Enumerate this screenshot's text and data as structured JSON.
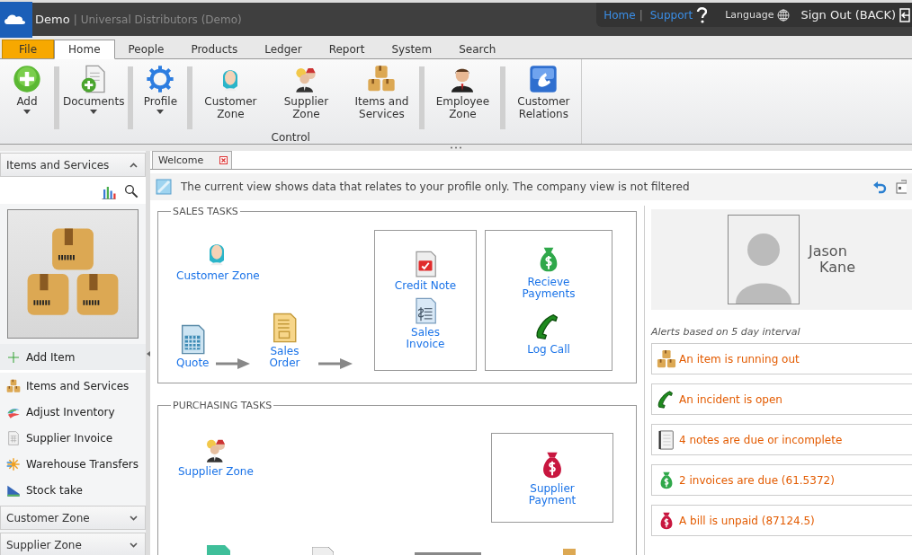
{
  "header": {
    "app": "Demo",
    "separator": "|",
    "company": "Universal Distributors (Demo)",
    "links": [
      {
        "label": "Home",
        "kind": "link"
      },
      {
        "label": "Support",
        "kind": "help"
      },
      {
        "label": "Language",
        "kind": "globe"
      },
      {
        "label": "Sign Out (BACK)",
        "kind": "exit"
      }
    ]
  },
  "menu_tabs": [
    {
      "label": "File",
      "kind": "file",
      "selected": false
    },
    {
      "label": "Home",
      "kind": "tab",
      "selected": true
    },
    {
      "label": "People",
      "kind": "tab",
      "selected": false
    },
    {
      "label": "Products",
      "kind": "tab",
      "selected": false
    },
    {
      "label": "Ledger",
      "kind": "tab",
      "selected": false
    },
    {
      "label": "Report",
      "kind": "tab",
      "selected": false
    },
    {
      "label": "System",
      "kind": "tab",
      "selected": false
    },
    {
      "label": "Search",
      "kind": "tab",
      "selected": false
    }
  ],
  "ribbon": {
    "group_label": "Control",
    "buttons": [
      {
        "label": "Add",
        "kind": "add",
        "dropdown": true
      },
      {
        "label": "Documents",
        "kind": "documents",
        "dropdown": true
      },
      {
        "label": "Profile",
        "kind": "gear",
        "dropdown": true
      },
      {
        "label": "Customer Zone",
        "kind": "customer",
        "dropdown": false
      },
      {
        "label": "Supplier Zone",
        "kind": "supplier",
        "dropdown": false
      },
      {
        "label": "Items and Services",
        "kind": "boxes",
        "dropdown": false
      },
      {
        "label": "Employee Zone",
        "kind": "employee",
        "dropdown": false
      },
      {
        "label": "Customer Relations",
        "kind": "phonetile",
        "dropdown": false
      }
    ]
  },
  "sidebar": {
    "title": "Items and Services",
    "expanded": true,
    "actions": [
      {
        "label": "Add Item",
        "kind": "plusthin",
        "highlighted": true
      },
      {
        "label": "Items and Services",
        "kind": "boxes",
        "highlighted": false
      },
      {
        "label": "Adjust Inventory",
        "kind": "swirl",
        "highlighted": false
      },
      {
        "label": "Supplier Invoice",
        "kind": "calc",
        "highlighted": false
      },
      {
        "label": "Warehouse Transfers",
        "kind": "transfer",
        "highlighted": false
      },
      {
        "label": "Stock take",
        "kind": "ruler",
        "highlighted": false
      }
    ],
    "panels": [
      {
        "label": "Customer Zone",
        "expanded": false
      },
      {
        "label": "Supplier Zone",
        "expanded": false
      }
    ]
  },
  "document_tab": {
    "label": "Welcome"
  },
  "notice": "The current view shows data that relates to your profile only. The company view is not filtered",
  "sales_tasks": {
    "title": "SALES TASKS",
    "items": [
      {
        "label": "Customer Zone",
        "kind": "customer"
      },
      {
        "label": "Quote",
        "kind": "quote"
      },
      {
        "label": "Sales Order",
        "kind": "order"
      },
      {
        "label": "Credit Note",
        "kind": "credit"
      },
      {
        "label": "Sales Invoice",
        "kind": "invoice"
      },
      {
        "label": "Recieve Payments",
        "kind": "bag"
      },
      {
        "label": "Log Call",
        "kind": "phone"
      }
    ]
  },
  "purchasing_tasks": {
    "title": "PURCHASING TASKS",
    "items": [
      {
        "label": "Supplier Zone",
        "kind": "supplier"
      },
      {
        "label": "Supplier Payment",
        "kind": "redbag"
      }
    ]
  },
  "profile": {
    "first_name": "Jason",
    "last_name": "Kane"
  },
  "alerts_title": "Alerts based on 5 day interval",
  "alerts": [
    {
      "text": "An item is running out",
      "kind": "boxes"
    },
    {
      "text": "An incident is open",
      "kind": "phone"
    },
    {
      "text": "4 notes are due or incomplete",
      "kind": "notebook"
    },
    {
      "text": "2 invoices are due (61.5372)",
      "kind": "bag"
    },
    {
      "text": "A bill is unpaid (87124.5)",
      "kind": "redbag"
    }
  ]
}
